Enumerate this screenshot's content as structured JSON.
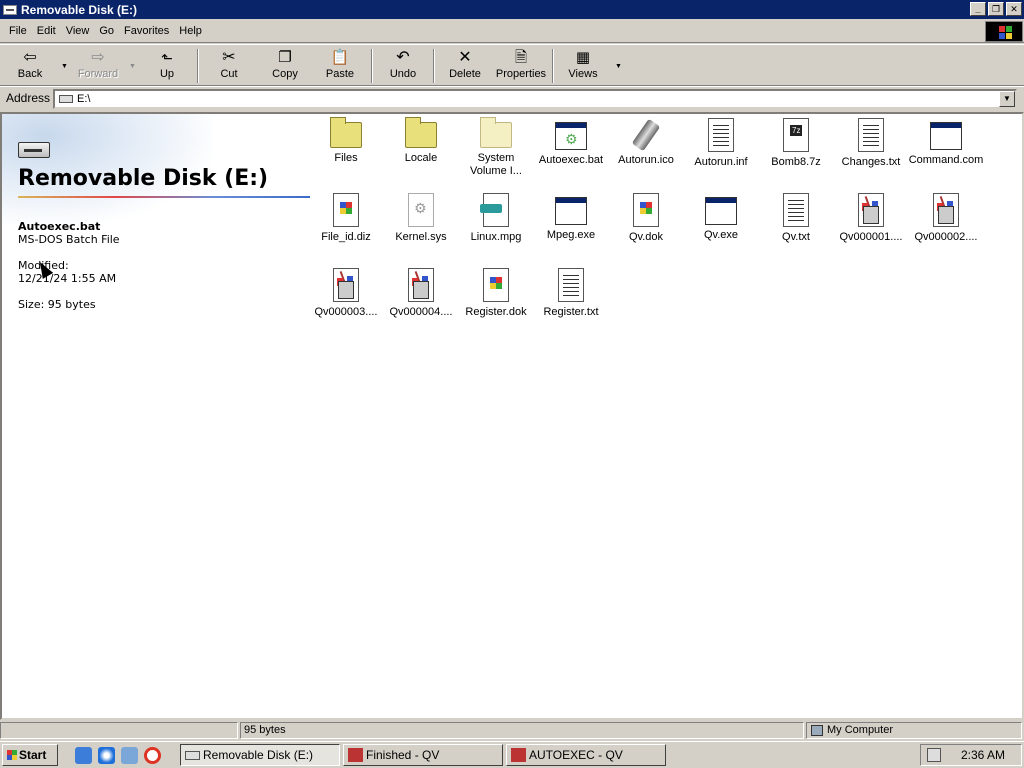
{
  "window": {
    "title": "Removable Disk (E:)"
  },
  "menu": [
    "File",
    "Edit",
    "View",
    "Go",
    "Favorites",
    "Help"
  ],
  "toolbar": {
    "back": "Back",
    "forward": "Forward",
    "up": "Up",
    "cut": "Cut",
    "copy": "Copy",
    "paste": "Paste",
    "undo": "Undo",
    "delete": "Delete",
    "properties": "Properties",
    "views": "Views"
  },
  "address": {
    "label": "Address",
    "value": "E:\\"
  },
  "left_pane": {
    "title": "Removable Disk (E:)",
    "selected_name": "Autoexec.bat",
    "selected_type": "MS-DOS Batch File",
    "modified_label": "Modified:",
    "modified_value": "12/21/24 1:55 AM",
    "size_text": "Size: 95 bytes"
  },
  "items": [
    {
      "name": "Files",
      "icon": "folder-icon"
    },
    {
      "name": "Locale",
      "icon": "folder-icon"
    },
    {
      "name": "System Volume I...",
      "icon": "system-folder-icon"
    },
    {
      "name": "Autoexec.bat",
      "icon": "batch-file-icon"
    },
    {
      "name": "Autorun.ico",
      "icon": "usb-drive-icon"
    },
    {
      "name": "Autorun.inf",
      "icon": "settings-file-icon"
    },
    {
      "name": "Bomb8.7z",
      "icon": "7z-archive-icon"
    },
    {
      "name": "Changes.txt",
      "icon": "text-file-icon"
    },
    {
      "name": "Command.com",
      "icon": "application-icon"
    },
    {
      "name": "File_id.diz",
      "icon": "document-icon"
    },
    {
      "name": "Kernel.sys",
      "icon": "system-file-icon"
    },
    {
      "name": "Linux.mpg",
      "icon": "video-file-icon"
    },
    {
      "name": "Mpeg.exe",
      "icon": "application-icon"
    },
    {
      "name": "Qv.dok",
      "icon": "document-icon"
    },
    {
      "name": "Qv.exe",
      "icon": "application-icon"
    },
    {
      "name": "Qv.txt",
      "icon": "text-file-icon"
    },
    {
      "name": "Qv000001....",
      "icon": "pencil-cup-icon"
    },
    {
      "name": "Qv000002....",
      "icon": "pencil-cup-icon"
    },
    {
      "name": "Qv000003....",
      "icon": "pencil-cup-icon"
    },
    {
      "name": "Qv000004....",
      "icon": "pencil-cup-icon"
    },
    {
      "name": "Register.dok",
      "icon": "document-icon"
    },
    {
      "name": "Register.txt",
      "icon": "text-file-icon"
    }
  ],
  "statusbar": {
    "size": "95 bytes",
    "zone": "My Computer"
  },
  "taskbar": {
    "start": "Start",
    "tasks": [
      "Removable Disk (E:)",
      "Finished - QV",
      "AUTOEXEC - QV"
    ],
    "clock": "2:36 AM"
  }
}
